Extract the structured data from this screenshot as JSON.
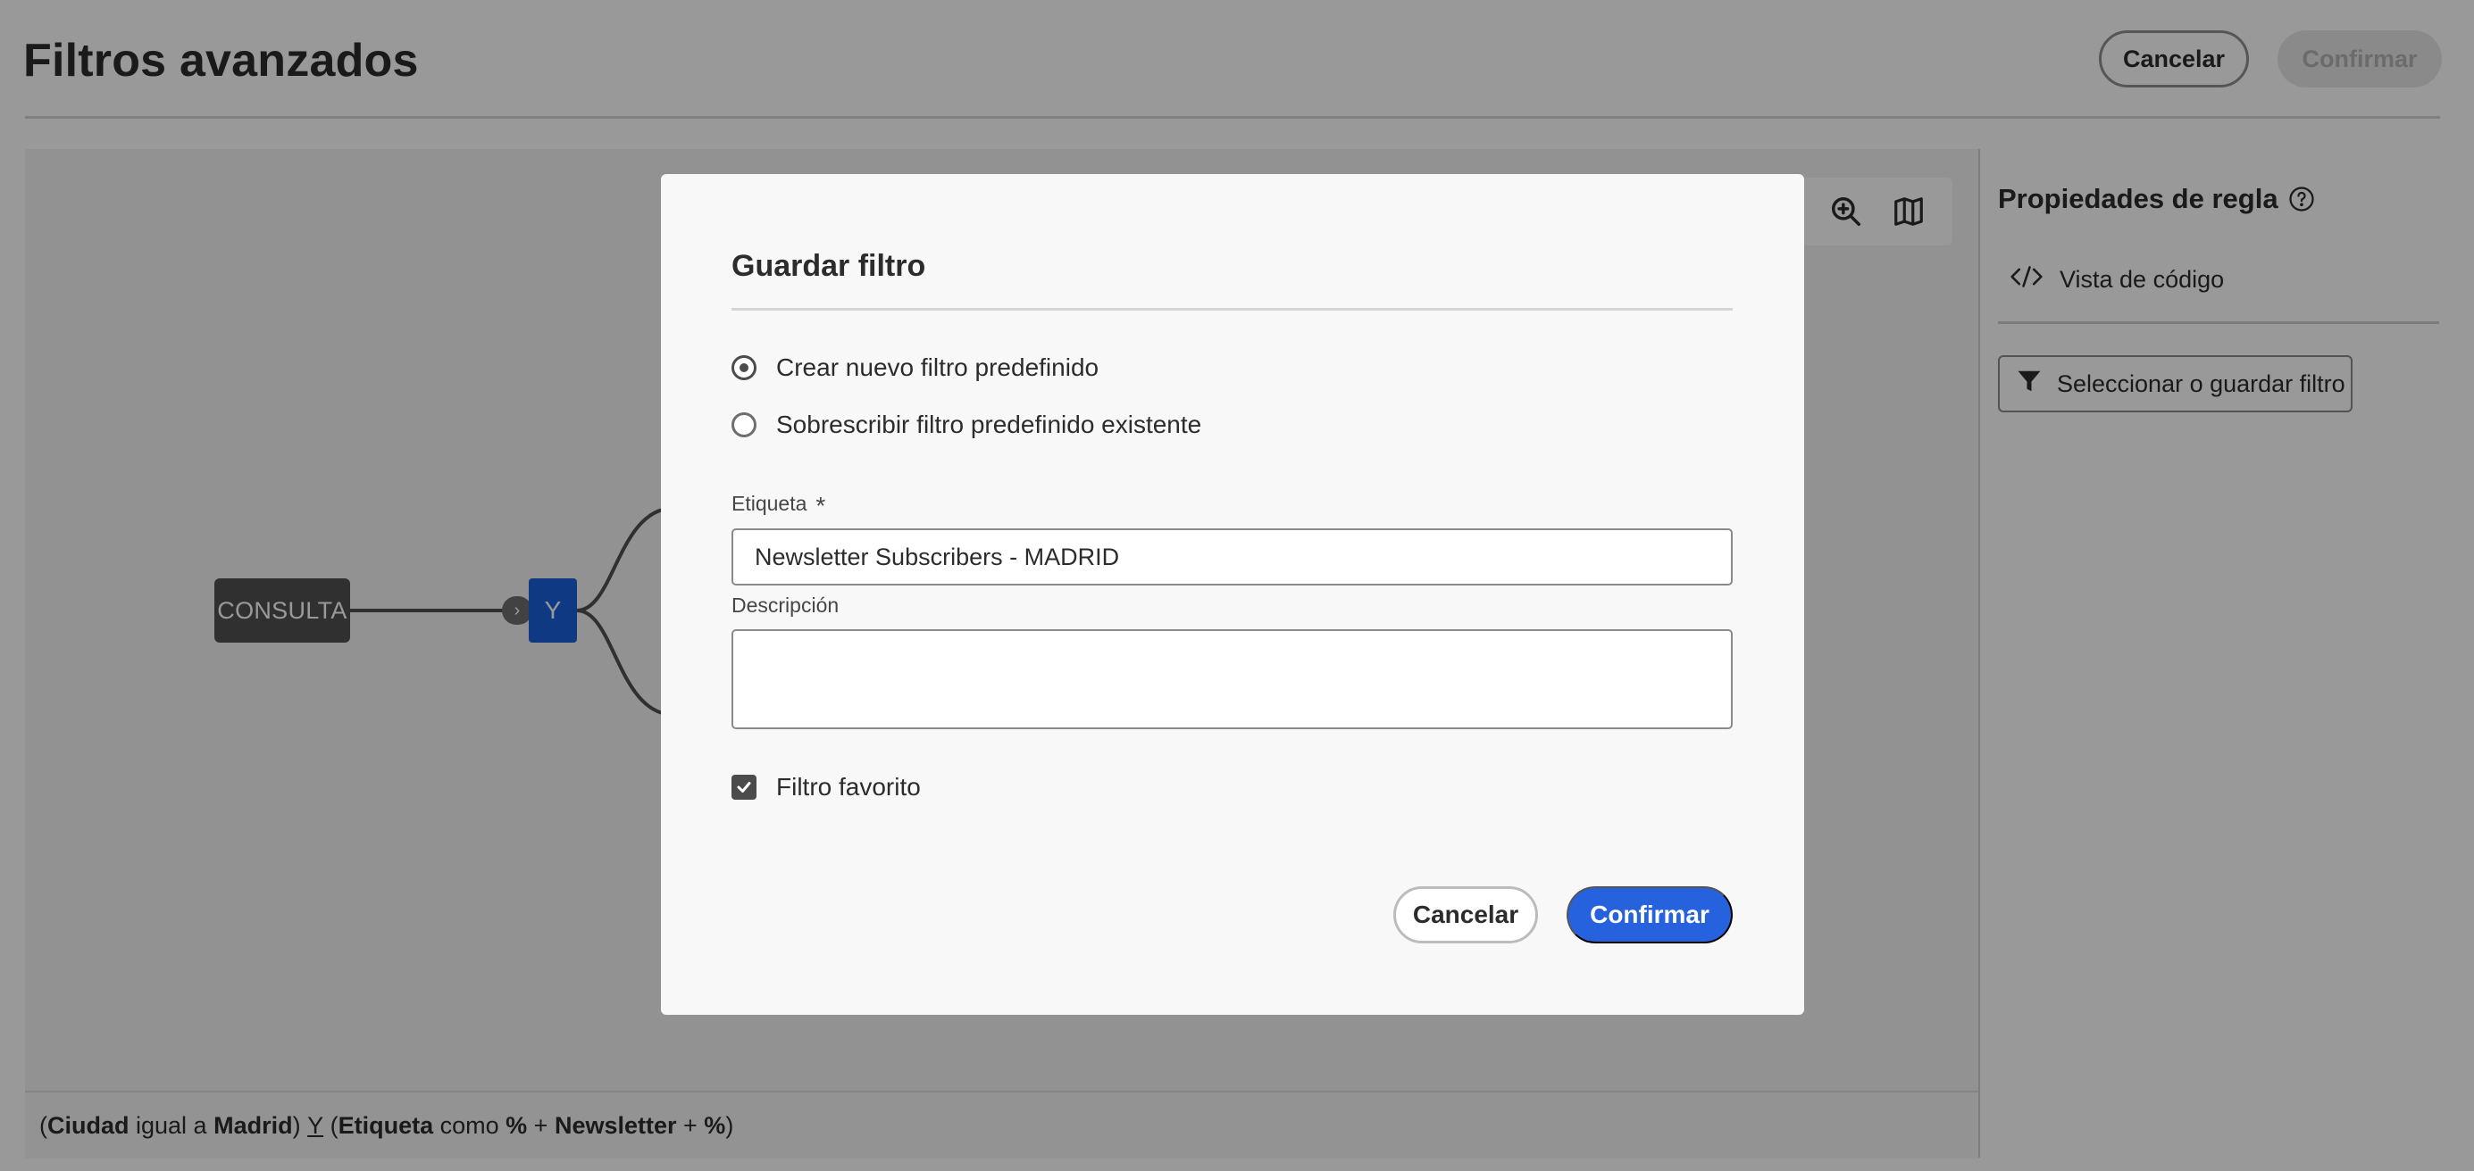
{
  "header": {
    "title": "Filtros avanzados",
    "cancel_label": "Cancelar",
    "confirm_label": "Confirmar"
  },
  "canvas": {
    "tools": [
      "zoom-in-icon",
      "map-icon"
    ],
    "nodes": {
      "query_label": "CONSULTA",
      "and_label": "Y"
    },
    "formula": {
      "p1": "(",
      "field1": "Ciudad",
      "op1": " igual a ",
      "val1": "Madrid",
      "p2": ") ",
      "conj": "Y",
      "p3": " (",
      "field2": "Etiqueta",
      "op2": " como ",
      "pct1": "%",
      "plus1": " + ",
      "val2": "Newsletter",
      "plus2": " + ",
      "pct2": "%",
      "p4": ")"
    }
  },
  "right_panel": {
    "title": "Propiedades de regla",
    "code_view_label": "Vista de código",
    "select_filter_label": "Seleccionar o guardar filtro"
  },
  "dialog": {
    "title": "Guardar filtro",
    "options": [
      {
        "label": "Crear nuevo filtro predefinido",
        "checked": true
      },
      {
        "label": "Sobrescribir filtro predefinido existente",
        "checked": false
      }
    ],
    "label_field": {
      "label": "Etiqueta",
      "required_mark": "*",
      "value": "Newsletter Subscribers - MADRID"
    },
    "description_field": {
      "label": "Descripción",
      "value": ""
    },
    "favorite": {
      "label": "Filtro favorito",
      "checked": true
    },
    "cancel_label": "Cancelar",
    "confirm_label": "Confirmar"
  },
  "colors": {
    "accent": "#2762de",
    "and_node": "#1c5fdc",
    "query_node": "#505050"
  }
}
